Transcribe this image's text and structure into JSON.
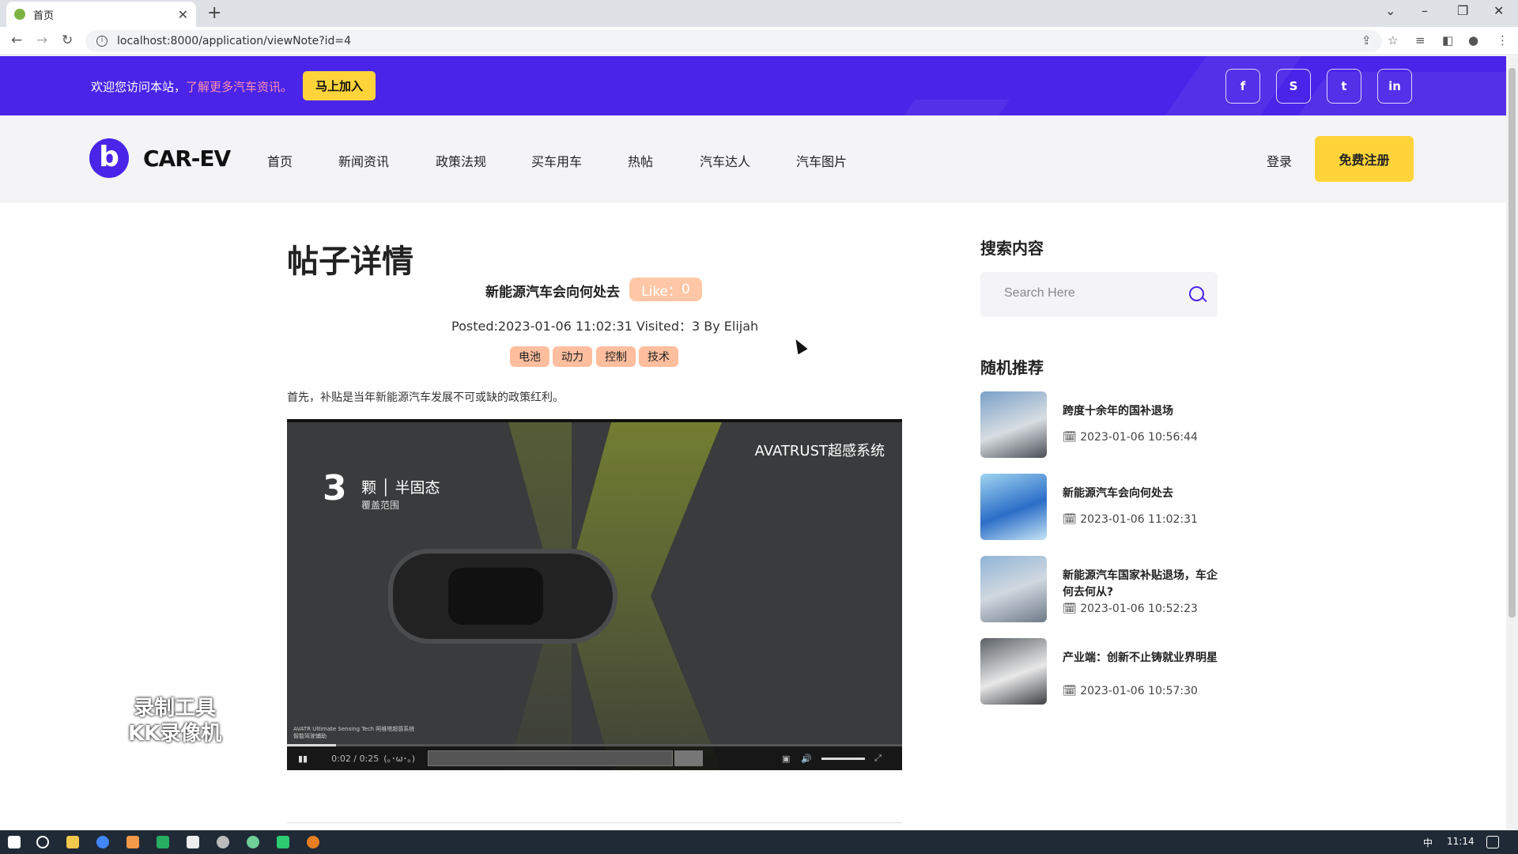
{
  "browser": {
    "tab_title": "首页",
    "url": "localhost:8000/application/viewNote?id=4"
  },
  "topbar": {
    "welcome": "欢迎您访问本站，",
    "welcome_link": "了解更多汽车资讯。",
    "join_label": "马上加入",
    "social": [
      "f",
      "S",
      "t",
      "in"
    ],
    "bg_color": "#4a24e8"
  },
  "header": {
    "logo_text": "CAR-EV",
    "nav": [
      "首页",
      "新闻资讯",
      "政策法规",
      "买车用车",
      "热帖",
      "汽车达人",
      "汽车图片"
    ],
    "login": "登录",
    "register": "免费注册",
    "accent": "#ffd43b"
  },
  "post": {
    "page_title": "帖子详情",
    "title": "新能源汽车会向何处去",
    "like_label": "Like：",
    "like_count": "0",
    "meta": "Posted:2023-01-06 11:02:31 Visited：3 By Elijah",
    "tags": [
      "电池",
      "动力",
      "控制",
      "技术"
    ],
    "intro": "首先，补贴是当年新能源汽车发展不可或缺的政策红利。"
  },
  "video": {
    "brand": "AVATRUST超感系统",
    "big_number": "3",
    "unit": "颗",
    "label": "半固态",
    "sublabel": "覆盖范围",
    "time": "0:02 / 0:25",
    "danmu": "(｡･ω･｡)",
    "progress": 0.08,
    "tiny_text": "AVATR Ultimate Sensing Tech 阿维塔超感系统 智能驾驶辅助"
  },
  "watermark": {
    "line1": "录制工具",
    "line2": "KK录像机"
  },
  "sidebar": {
    "search_heading": "搜索内容",
    "search_placeholder": "Search Here",
    "rec_heading": "随机推荐",
    "items": [
      {
        "title": "跨度十余年的国补退场",
        "date": "2023-01-06 10:56:44"
      },
      {
        "title": "新能源汽车会向何处去",
        "date": "2023-01-06 11:02:31"
      },
      {
        "title": "新能源汽车国家补贴退场，车企何去何从?",
        "date": "2023-01-06 10:52:23"
      },
      {
        "title": "产业端：创新不止铸就业界明星",
        "date": "2023-01-06 10:57:30"
      }
    ]
  },
  "taskbar": {
    "time": "11:14",
    "ime": "中"
  }
}
